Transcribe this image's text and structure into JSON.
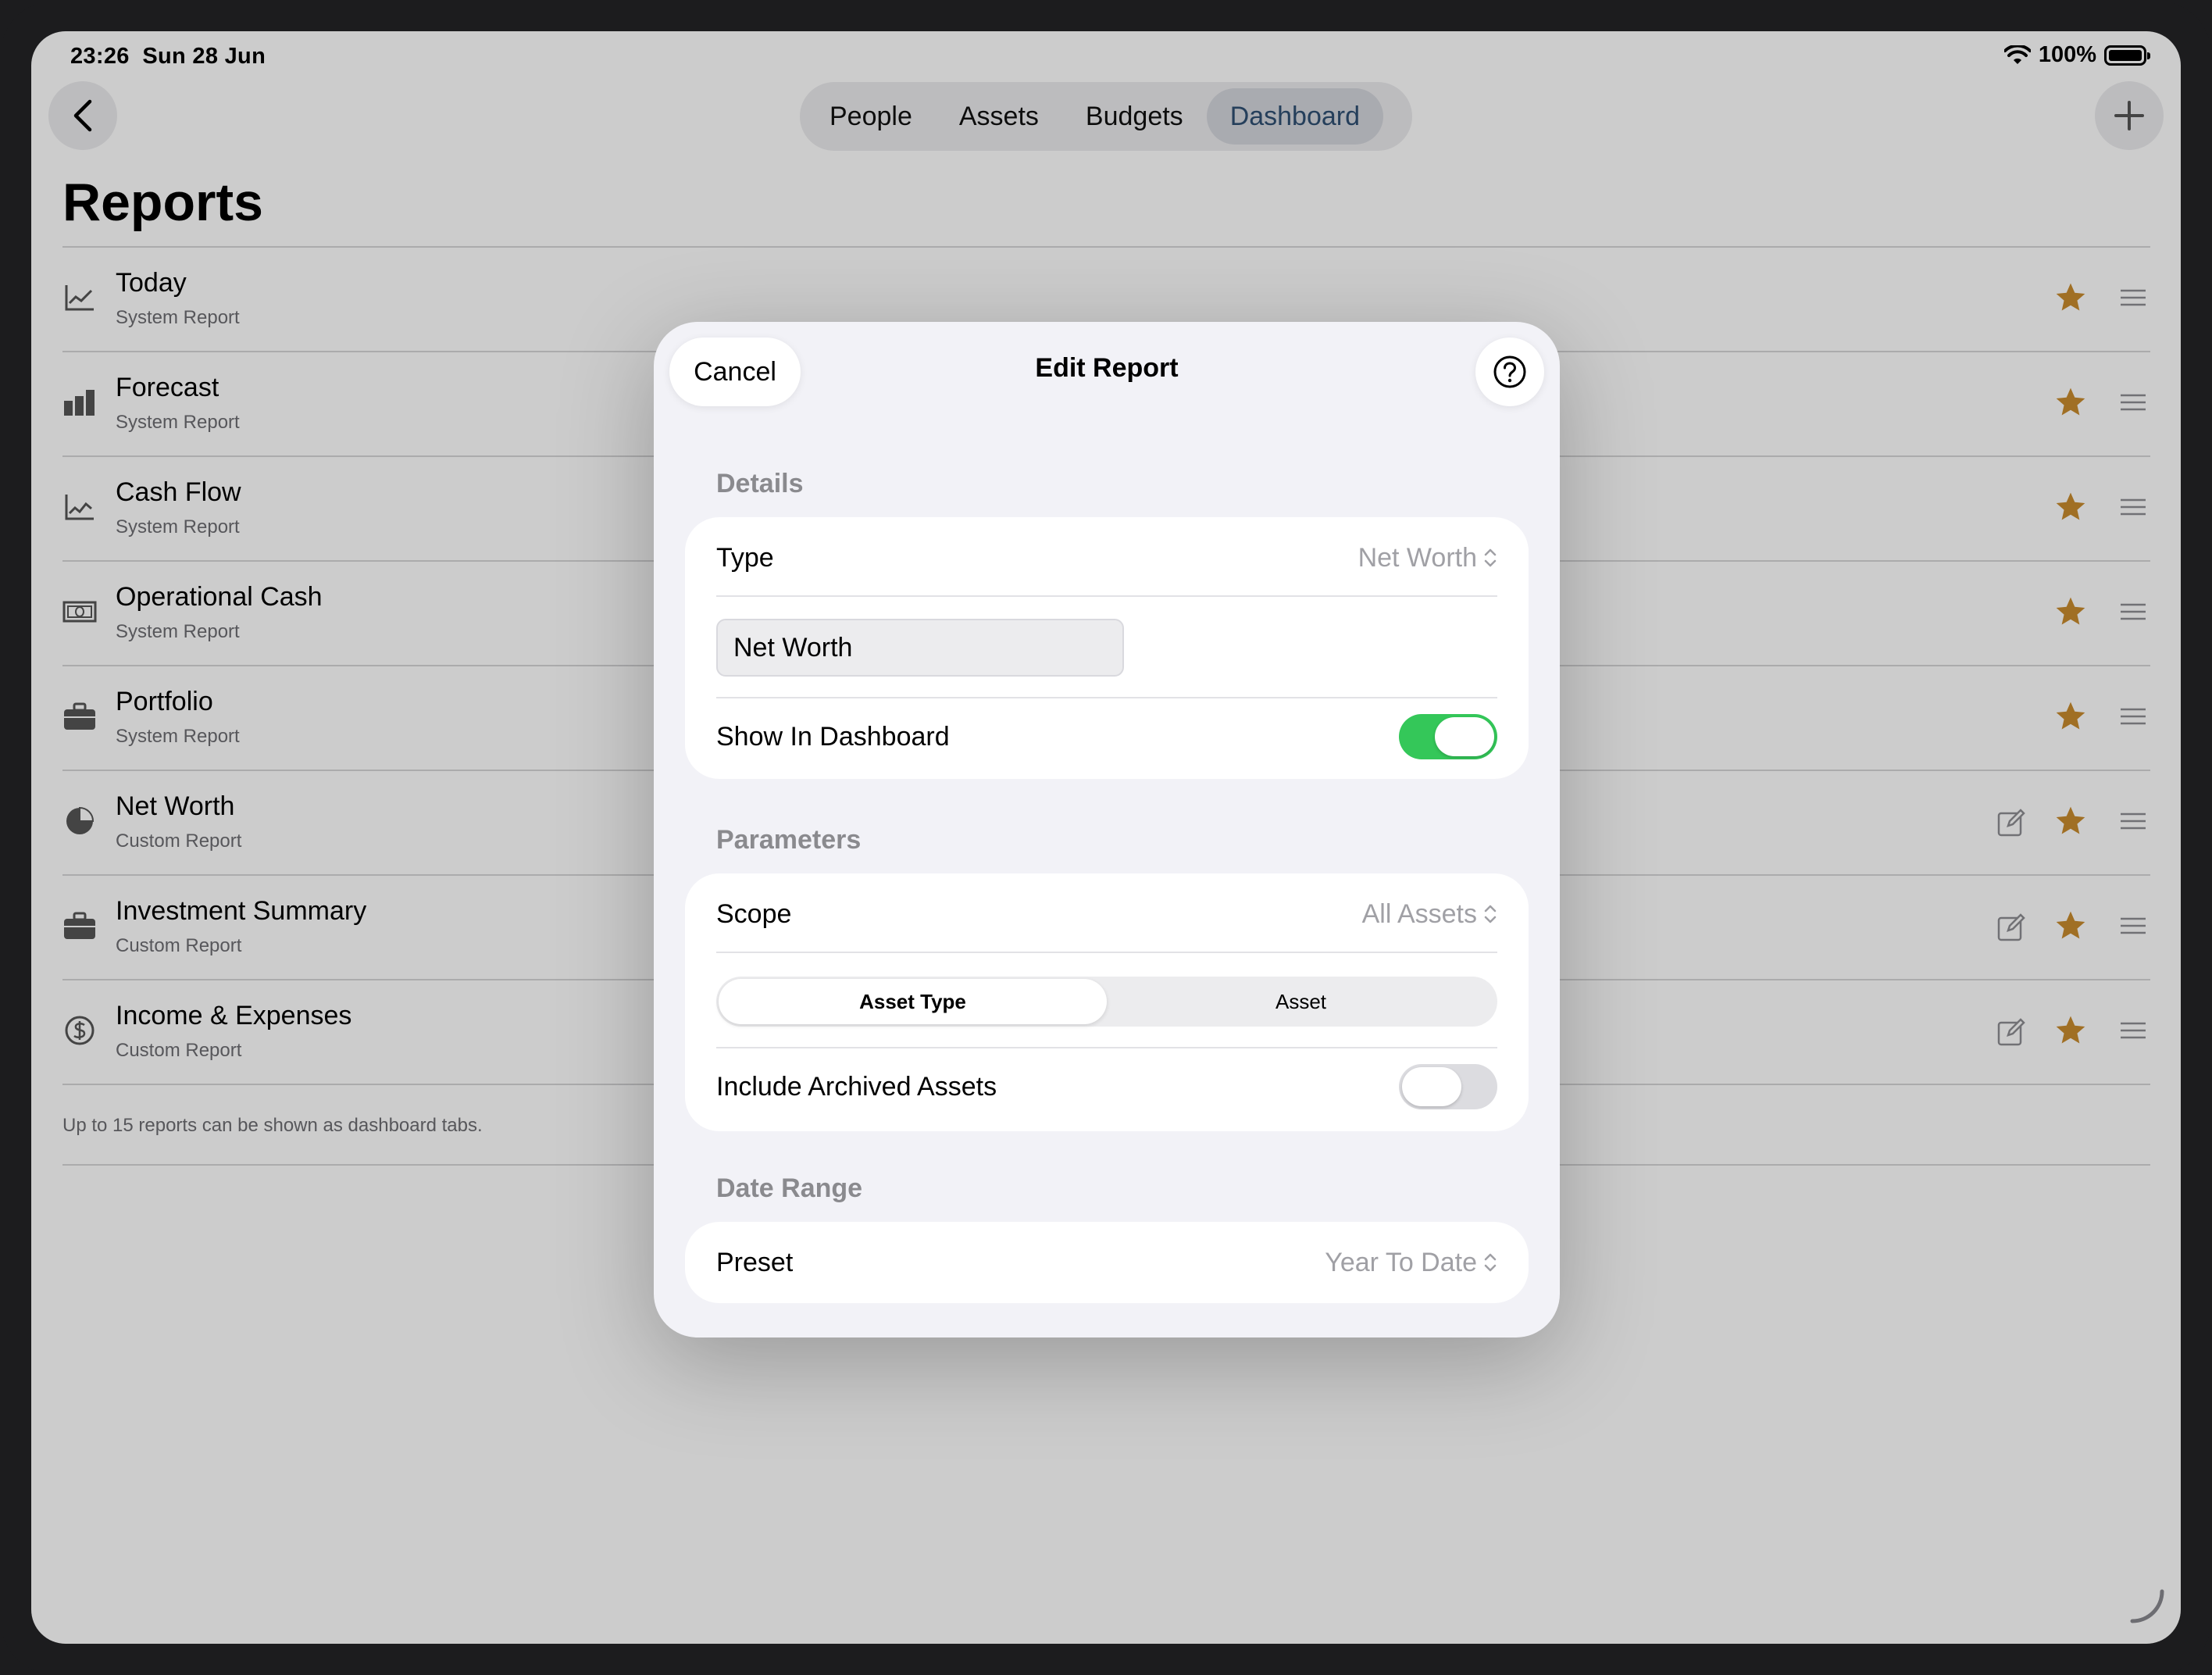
{
  "status_bar": {
    "time": "23:26",
    "date": "Sun 28 Jun",
    "battery": "100%"
  },
  "nav": {
    "tabs": [
      {
        "label": "People",
        "active": false
      },
      {
        "label": "Assets",
        "active": false
      },
      {
        "label": "Budgets",
        "active": false
      },
      {
        "label": "Dashboard",
        "active": true
      }
    ]
  },
  "page": {
    "title": "Reports",
    "reports": [
      {
        "name": "Today",
        "subtitle": "System Report",
        "icon": "line-chart-icon",
        "editable": false
      },
      {
        "name": "Forecast",
        "subtitle": "System Report",
        "icon": "bar-chart-icon",
        "editable": false
      },
      {
        "name": "Cash Flow",
        "subtitle": "System Report",
        "icon": "line-chart-icon",
        "editable": false
      },
      {
        "name": "Operational Cash",
        "subtitle": "System Report",
        "icon": "banknote-icon",
        "editable": false
      },
      {
        "name": "Portfolio",
        "subtitle": "System Report",
        "icon": "briefcase-icon",
        "editable": false
      },
      {
        "name": "Net Worth",
        "subtitle": "Custom Report",
        "icon": "pie-chart-icon",
        "editable": true
      },
      {
        "name": "Investment Summary",
        "subtitle": "Custom Report",
        "icon": "briefcase-icon",
        "editable": true
      },
      {
        "name": "Income & Expenses",
        "subtitle": "Custom Report",
        "icon": "dollar-circle-icon",
        "editable": true
      }
    ],
    "footer_note": "Up to 15 reports can be shown as dashboard tabs."
  },
  "modal": {
    "cancel_label": "Cancel",
    "title": "Edit Report",
    "details": {
      "header": "Details",
      "type_label": "Type",
      "type_value": "Net Worth",
      "name_value": "Net Worth",
      "show_in_dashboard_label": "Show In Dashboard",
      "show_in_dashboard": true
    },
    "parameters": {
      "header": "Parameters",
      "scope_label": "Scope",
      "scope_value": "All Assets",
      "segments": [
        "Asset Type",
        "Asset"
      ],
      "selected_segment": "Asset Type",
      "include_archived_label": "Include Archived Assets",
      "include_archived": false
    },
    "date_range": {
      "header": "Date Range",
      "preset_label": "Preset",
      "preset_value": "Year To Date"
    }
  },
  "colors": {
    "accent_star": "#c98b2e",
    "toggle_on": "#34c759",
    "active_tab_text": "#2f4f72"
  }
}
